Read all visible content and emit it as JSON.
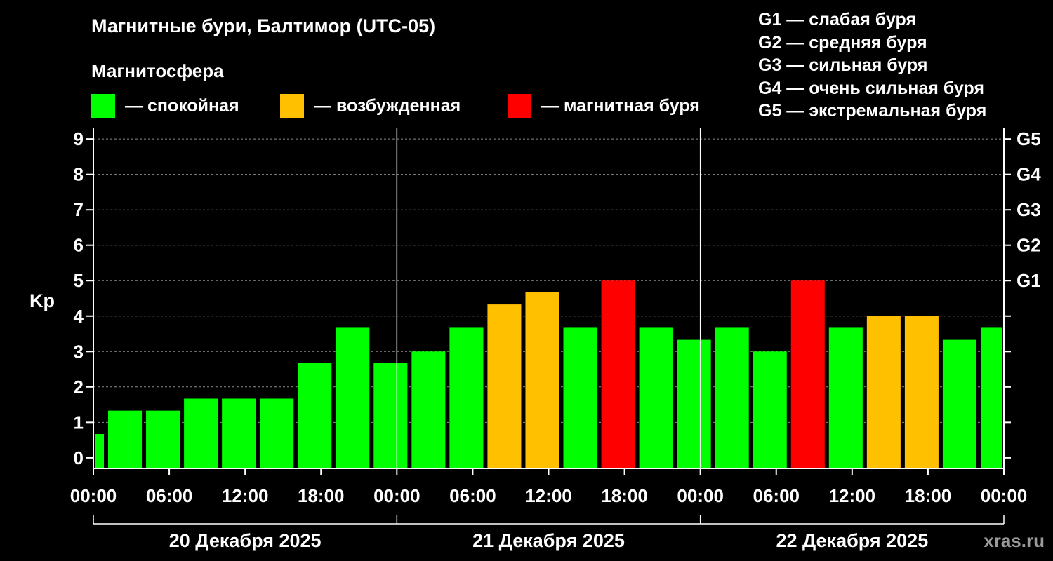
{
  "title": "Магнитные бури, Балтимор (UTC-05)",
  "subtitle": "Магнитосфера",
  "legend": [
    {
      "label": "— спокойная",
      "color": "#00ff00"
    },
    {
      "label": "— возбужденная",
      "color": "#ffc000"
    },
    {
      "label": "— магнитная буря",
      "color": "#ff0000"
    }
  ],
  "g_scale": [
    {
      "level": "G1",
      "desc": "G1 — слабая буря"
    },
    {
      "level": "G2",
      "desc": "G2 — средняя буря"
    },
    {
      "level": "G3",
      "desc": "G3 — сильная буря"
    },
    {
      "level": "G4",
      "desc": "G4 — очень сильная буря"
    },
    {
      "level": "G5",
      "desc": "G5 — экстремальная буря"
    }
  ],
  "watermark": "xras.ru",
  "chart_data": {
    "type": "bar",
    "ylabel": "Kp",
    "ylim": [
      -0.3,
      9.3
    ],
    "yticks": [
      0,
      1,
      2,
      3,
      4,
      5,
      6,
      7,
      8,
      9
    ],
    "right_labels": [
      {
        "kp": 5,
        "label": "G1"
      },
      {
        "kp": 6,
        "label": "G2"
      },
      {
        "kp": 7,
        "label": "G3"
      },
      {
        "kp": 8,
        "label": "G4"
      },
      {
        "kp": 9,
        "label": "G5"
      }
    ],
    "x_range_hours": [
      0,
      72
    ],
    "x_tick_labels": [
      "00:00",
      "06:00",
      "12:00",
      "18:00",
      "00:00",
      "06:00",
      "12:00",
      "18:00",
      "00:00",
      "06:00",
      "12:00",
      "18:00",
      "00:00"
    ],
    "days": [
      "20 Декабря 2025",
      "21 Декабря 2025",
      "22 Декабря 2025"
    ],
    "grid": true,
    "colors": {
      "quiet": "#00ff00",
      "active": "#ffc000",
      "storm": "#ff0000"
    },
    "bars": [
      {
        "start": 0,
        "end": 1,
        "kp": 0.67,
        "level": "quiet"
      },
      {
        "start": 1,
        "end": 4,
        "kp": 1.33,
        "level": "quiet"
      },
      {
        "start": 4,
        "end": 7,
        "kp": 1.33,
        "level": "quiet"
      },
      {
        "start": 7,
        "end": 10,
        "kp": 1.67,
        "level": "quiet"
      },
      {
        "start": 10,
        "end": 13,
        "kp": 1.67,
        "level": "quiet"
      },
      {
        "start": 13,
        "end": 16,
        "kp": 1.67,
        "level": "quiet"
      },
      {
        "start": 16,
        "end": 19,
        "kp": 2.67,
        "level": "quiet"
      },
      {
        "start": 19,
        "end": 22,
        "kp": 3.67,
        "level": "quiet"
      },
      {
        "start": 22,
        "end": 25,
        "kp": 2.67,
        "level": "quiet"
      },
      {
        "start": 25,
        "end": 28,
        "kp": 3.0,
        "level": "quiet"
      },
      {
        "start": 28,
        "end": 31,
        "kp": 3.67,
        "level": "quiet"
      },
      {
        "start": 31,
        "end": 34,
        "kp": 4.33,
        "level": "active"
      },
      {
        "start": 34,
        "end": 37,
        "kp": 4.67,
        "level": "active"
      },
      {
        "start": 37,
        "end": 40,
        "kp": 3.67,
        "level": "quiet"
      },
      {
        "start": 40,
        "end": 43,
        "kp": 5.0,
        "level": "storm"
      },
      {
        "start": 43,
        "end": 46,
        "kp": 3.67,
        "level": "quiet"
      },
      {
        "start": 46,
        "end": 49,
        "kp": 3.33,
        "level": "quiet"
      },
      {
        "start": 49,
        "end": 52,
        "kp": 3.67,
        "level": "quiet"
      },
      {
        "start": 52,
        "end": 55,
        "kp": 3.0,
        "level": "quiet"
      },
      {
        "start": 55,
        "end": 58,
        "kp": 5.0,
        "level": "storm"
      },
      {
        "start": 58,
        "end": 61,
        "kp": 3.67,
        "level": "quiet"
      },
      {
        "start": 61,
        "end": 64,
        "kp": 4.0,
        "level": "active"
      },
      {
        "start": 64,
        "end": 67,
        "kp": 4.0,
        "level": "active"
      },
      {
        "start": 67,
        "end": 70,
        "kp": 3.33,
        "level": "quiet"
      },
      {
        "start": 70,
        "end": 72,
        "kp": 3.67,
        "level": "quiet"
      }
    ]
  }
}
